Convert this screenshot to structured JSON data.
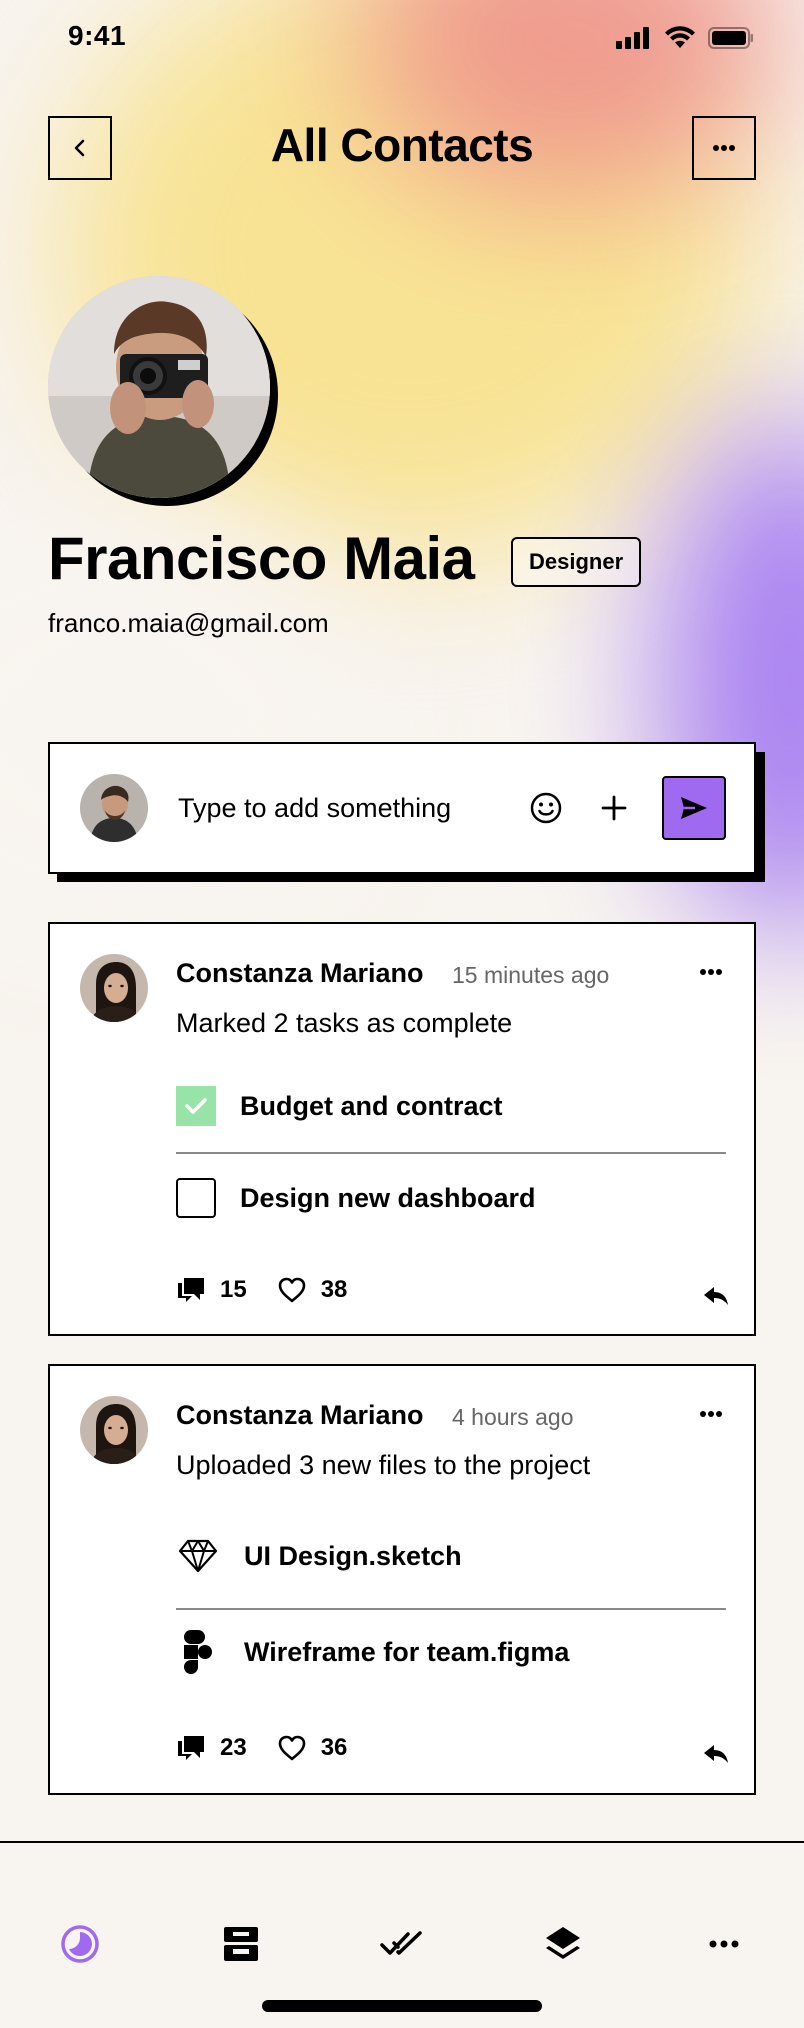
{
  "status_bar": {
    "time": "9:41"
  },
  "header": {
    "title": "All Contacts"
  },
  "profile": {
    "name": "Francisco Maia",
    "role": "Designer",
    "email": "franco.maia@gmail.com"
  },
  "composer": {
    "placeholder": "Type to add something"
  },
  "activity": [
    {
      "author": "Constanza Mariano",
      "time": "15 minutes ago",
      "description": "Marked 2 tasks as complete",
      "tasks": [
        {
          "label": "Budget and contract",
          "done": true
        },
        {
          "label": "Design new dashboard",
          "done": false
        }
      ],
      "comments": "15",
      "likes": "38"
    },
    {
      "author": "Constanza Mariano",
      "time": "4 hours ago",
      "description": "Uploaded 3 new files to the project",
      "files": [
        {
          "label": "UI Design.sketch",
          "icon": "sketch-icon"
        },
        {
          "label": "Wireframe for team.figma",
          "icon": "figma-icon"
        }
      ],
      "comments": "23",
      "likes": "36"
    }
  ],
  "nav": {
    "items": [
      "activity-icon",
      "inbox-icon",
      "done-all-icon",
      "layers-icon",
      "more-icon"
    ],
    "active": "activity-icon"
  },
  "colors": {
    "accent": "#a06af0",
    "check": "#98e3a8",
    "background": "#f8f4ef"
  }
}
